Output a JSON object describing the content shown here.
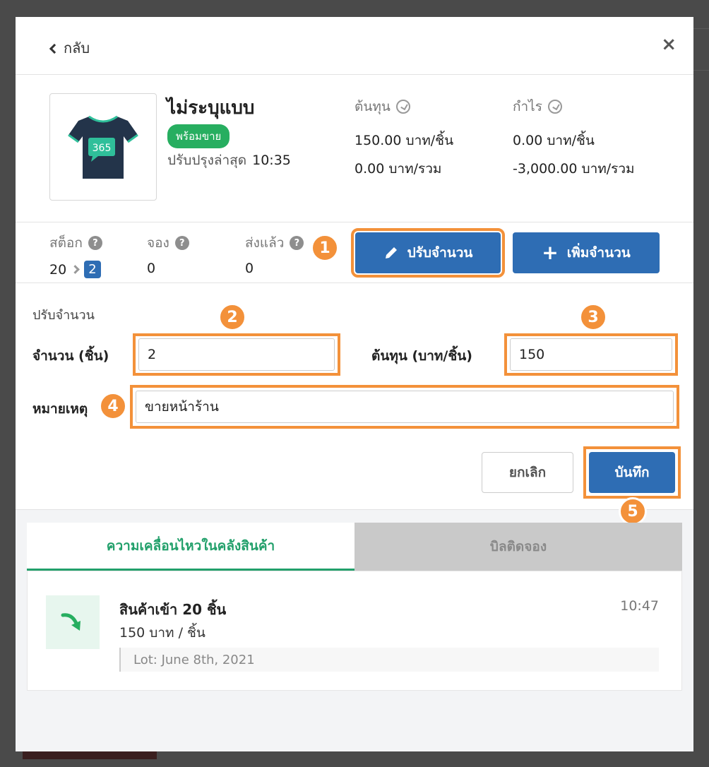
{
  "header": {
    "back_label": "กลับ",
    "close_label": "×"
  },
  "product": {
    "name": "ไม่ระบุแบบ",
    "status_badge": "พร้อมขาย",
    "updated_label": "ปรับปรุงล่าสุด",
    "updated_time": "10:35",
    "thumb_text": "365",
    "cost": {
      "label": "ต้นทุน",
      "per_piece": "150.00 บาท/ชิ้น",
      "total": "0.00 บาท/รวม"
    },
    "profit": {
      "label": "กำไร",
      "per_piece": "0.00 บาท/ชิ้น",
      "total": "-3,000.00 บาท/รวม"
    }
  },
  "stock": {
    "stock_label": "สต็อก",
    "stock_value": "20",
    "stock_new_value": "2",
    "reserved_label": "จอง",
    "reserved_value": "0",
    "shipped_label": "ส่งแล้ว",
    "shipped_value": "0",
    "help_icon_text": "?",
    "adjust_button": "ปรับจำนวน",
    "add_button": "เพิ่มจำนวน"
  },
  "adjust_form": {
    "title": "ปรับจำนวน",
    "quantity_label": "จำนวน (ชิ้น)",
    "quantity_value": "2",
    "cost_label": "ต้นทุน (บาท/ชิ้น)",
    "cost_value": "150",
    "note_label": "หมายเหตุ",
    "note_value": "ขายหน้าร้าน",
    "cancel_button": "ยกเลิก",
    "save_button": "บันทึก"
  },
  "steps": [
    "1",
    "2",
    "3",
    "4",
    "5"
  ],
  "tabs": [
    {
      "label": "ความเคลื่อนไหวในคลังสินค้า",
      "active": true
    },
    {
      "label": "บิลติดจอง",
      "active": false
    }
  ],
  "movements": [
    {
      "title": "สินค้าเข้า 20 ชิ้น",
      "price": "150 บาท / ชิ้น",
      "time": "10:47",
      "lot": "Lot: June 8th, 2021"
    }
  ],
  "colors": {
    "primary": "#2e6db4",
    "accent_green": "#22a06b",
    "highlight": "#f3913a",
    "badge_green": "#27ae60"
  }
}
